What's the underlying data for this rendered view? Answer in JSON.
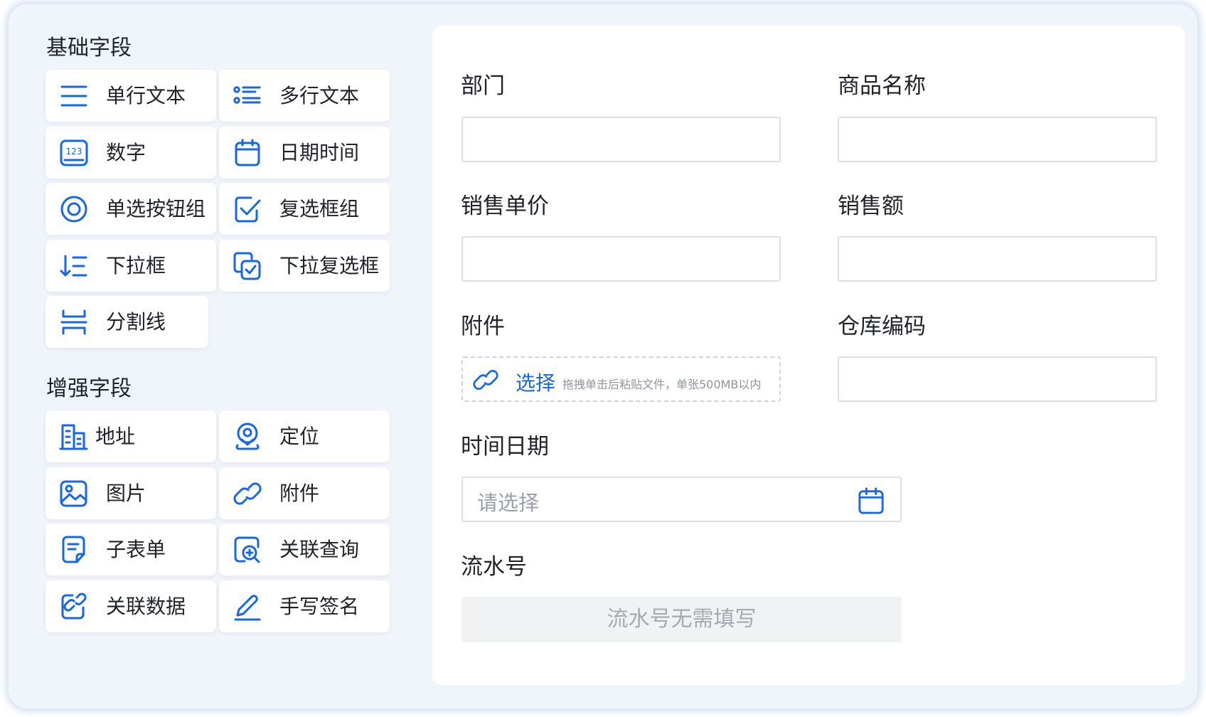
{
  "basic_fields": {
    "title": "基础字段",
    "items": [
      {
        "label": "单行文本",
        "icon": "single-line-text-icon"
      },
      {
        "label": "多行文本",
        "icon": "multi-line-text-icon"
      },
      {
        "label": "数字",
        "icon": "number-icon",
        "icon_text": "123"
      },
      {
        "label": "日期时间",
        "icon": "calendar-icon"
      },
      {
        "label": "单选按钮组",
        "icon": "radio-icon"
      },
      {
        "label": "复选框组",
        "icon": "checkbox-icon"
      },
      {
        "label": "下拉框",
        "icon": "sort-list-icon"
      },
      {
        "label": "下拉复选框",
        "icon": "multi-checkbox-icon"
      },
      {
        "label": "分割线",
        "icon": "divider-icon"
      }
    ]
  },
  "enhanced_fields": {
    "title": "增强字段",
    "items": [
      {
        "label": "地址",
        "icon": "building-icon"
      },
      {
        "label": "定位",
        "icon": "location-icon"
      },
      {
        "label": "图片",
        "icon": "image-icon"
      },
      {
        "label": "附件",
        "icon": "link-icon"
      },
      {
        "label": "子表单",
        "icon": "sub-form-icon"
      },
      {
        "label": "关联查询",
        "icon": "related-query-icon"
      },
      {
        "label": "关联数据",
        "icon": "related-data-icon"
      },
      {
        "label": "手写签名",
        "icon": "pen-icon"
      }
    ]
  },
  "form": {
    "department": {
      "label": "部门",
      "value": ""
    },
    "product_name": {
      "label": "商品名称",
      "value": ""
    },
    "unit_price": {
      "label": "销售单价",
      "value": ""
    },
    "sales_amount": {
      "label": "销售额",
      "value": ""
    },
    "attachment": {
      "label": "附件",
      "button": "选择",
      "hint": "拖拽单击后粘贴文件，单张500MB以内"
    },
    "warehouse_code": {
      "label": "仓库编码",
      "value": ""
    },
    "date_time": {
      "label": "时间日期",
      "placeholder": "请选择"
    },
    "serial_no": {
      "label": "流水号",
      "placeholder": "流水号无需填写"
    }
  },
  "colors": {
    "accent": "#1766e3",
    "frame_bg": "#f0f4fb",
    "text": "#1f2329",
    "border": "#dcdfe6",
    "placeholder": "#9aa0a8"
  }
}
